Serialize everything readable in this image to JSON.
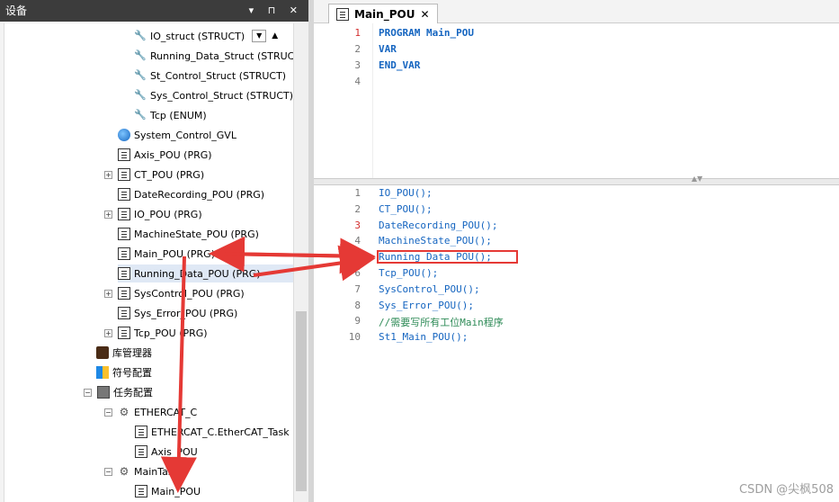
{
  "device_panel": {
    "title": "设备",
    "controls": "▾ ⊓ ✕"
  },
  "tree": [
    {
      "label": "IO_struct (STRUCT)",
      "icon": "struct-icon"
    },
    {
      "label": "Running_Data_Struct (STRUCT",
      "icon": "struct-icon"
    },
    {
      "label": "St_Control_Struct (STRUCT)",
      "icon": "struct-icon"
    },
    {
      "label": "Sys_Control_Struct (STRUCT)",
      "icon": "struct-icon"
    },
    {
      "label": "Tcp (ENUM)",
      "icon": "struct-icon"
    },
    {
      "label": "System_Control_GVL",
      "icon": "gvl-icon"
    },
    {
      "label": "Axis_POU (PRG)",
      "icon": "pou-icon"
    },
    {
      "label": "CT_POU (PRG)",
      "icon": "pou-icon"
    },
    {
      "label": "DateRecording_POU (PRG)",
      "icon": "pou-icon"
    },
    {
      "label": "IO_POU (PRG)",
      "icon": "pou-icon"
    },
    {
      "label": "MachineState_POU (PRG)",
      "icon": "pou-icon"
    },
    {
      "label": "Main_POU (PRG)",
      "icon": "pou-icon"
    },
    {
      "label": "Running_Data_POU (PRG)",
      "icon": "pou-icon"
    },
    {
      "label": "SysControl_POU (PRG)",
      "icon": "pou-icon"
    },
    {
      "label": "Sys_Error_POU (PRG)",
      "icon": "pou-icon"
    },
    {
      "label": "Tcp_POU (PRG)",
      "icon": "pou-icon"
    },
    {
      "label": "库管理器",
      "icon": "library-icon"
    },
    {
      "label": "符号配置",
      "icon": "symbol-icon"
    },
    {
      "label": "任务配置",
      "icon": "task-config-icon"
    },
    {
      "label": "ETHERCAT_C",
      "icon": "task-icon"
    },
    {
      "label": "ETHERCAT_C.EtherCAT_Task",
      "icon": "task-call-icon"
    },
    {
      "label": "Axis_POU",
      "icon": "task-call-icon"
    },
    {
      "label": "MainTask",
      "icon": "task-icon"
    },
    {
      "label": "Main_POU",
      "icon": "task-call-icon"
    }
  ],
  "editor": {
    "tab_label": "Main_POU",
    "decl_lines": [
      {
        "n": "1",
        "text": "PROGRAM Main_POU"
      },
      {
        "n": "2",
        "text": "VAR"
      },
      {
        "n": "3",
        "text": "END_VAR"
      },
      {
        "n": "4",
        "text": ""
      }
    ],
    "body_lines": [
      {
        "n": "1",
        "text": "IO_POU();"
      },
      {
        "n": "2",
        "text": "CT_POU();"
      },
      {
        "n": "3",
        "text": "DateRecording_POU();"
      },
      {
        "n": "4",
        "text": "MachineState_POU();"
      },
      {
        "n": "5",
        "text": "Running_Data_POU();"
      },
      {
        "n": "6",
        "text": "Tcp_POU();"
      },
      {
        "n": "7",
        "text": "SysControl_POU();"
      },
      {
        "n": "8",
        "text": "Sys_Error_POU();"
      },
      {
        "n": "9",
        "text": "//需要写所有工位Main程序"
      },
      {
        "n": "10",
        "text": "St1_Main_POU();"
      }
    ]
  },
  "watermark": "CSDN @尖枫508",
  "colors": {
    "accent": "#1565c0",
    "annotation": "#e53935"
  }
}
